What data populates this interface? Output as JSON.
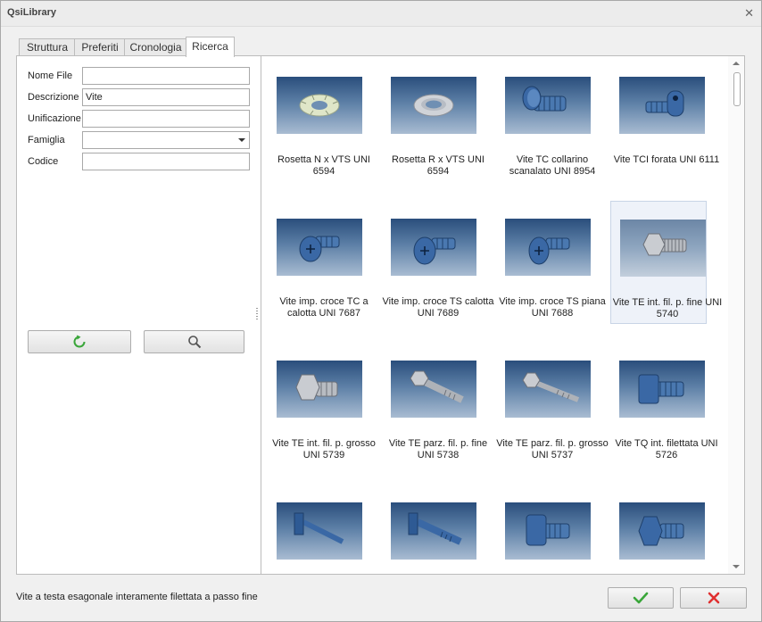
{
  "window": {
    "title": "QsiLibrary"
  },
  "tabs": [
    {
      "label": "Struttura"
    },
    {
      "label": "Preferiti"
    },
    {
      "label": "Cronologia"
    },
    {
      "label": "Ricerca",
      "active": true
    }
  ],
  "search_form": {
    "nome_file": {
      "label": "Nome File",
      "value": ""
    },
    "descrizione": {
      "label": "Descrizione",
      "value": "Vite"
    },
    "unificazione": {
      "label": "Unificazione",
      "value": ""
    },
    "famiglia": {
      "label": "Famiglia",
      "value": ""
    },
    "codice": {
      "label": "Codice",
      "value": ""
    },
    "reset_icon": "refresh-icon",
    "search_icon": "magnifier-icon"
  },
  "results": [
    {
      "caption": "Rosetta N x VTS UNI 6594",
      "icon": "toothed-washer"
    },
    {
      "caption": "Rosetta R x VTS UNI 6594",
      "icon": "countersunk-washer"
    },
    {
      "caption": "Vite TC collarino scanalato UNI 8954",
      "icon": "collar-screw"
    },
    {
      "caption": "Vite TCI forata UNI 6111",
      "icon": "drilled-socket-screw"
    },
    {
      "caption": "Vite imp. croce TC a calotta UNI 7687",
      "icon": "pan-cross-screw"
    },
    {
      "caption": "Vite imp. croce TS calotta UNI 7689",
      "icon": "raised-countersunk-screw"
    },
    {
      "caption": "Vite imp. croce TS piana UNI 7688",
      "icon": "flat-countersunk-screw"
    },
    {
      "caption": "Vite TE int. fil. p. fine UNI 5740",
      "icon": "hex-screw-fine",
      "selected": true
    },
    {
      "caption": "Vite TE int. fil. p. grosso UNI 5739",
      "icon": "hex-screw-coarse"
    },
    {
      "caption": "Vite TE parz. fil. p. fine UNI 5738",
      "icon": "hex-bolt-partial-fine"
    },
    {
      "caption": "Vite TE parz. fil. p. grosso UNI 5737",
      "icon": "hex-bolt-partial-coarse"
    },
    {
      "caption": "Vite TQ int. filettata UNI 5726",
      "icon": "square-head-screw"
    },
    {
      "caption": "",
      "icon": "t-head-bolt"
    },
    {
      "caption": "",
      "icon": "t-head-bolt-threaded"
    },
    {
      "caption": "",
      "icon": "blue-collar-screw"
    },
    {
      "caption": "",
      "icon": "blue-hex-collar-screw"
    }
  ],
  "status_text": "Vite a testa esagonale interamente filettata a passo fine",
  "dialog_buttons": {
    "ok_icon": "check-icon",
    "cancel_icon": "cross-icon"
  },
  "colors": {
    "ok": "#3aa63a",
    "cancel": "#e03030",
    "thumb_bg_top": "#2a4e7c",
    "selection": "#eef2f9"
  }
}
